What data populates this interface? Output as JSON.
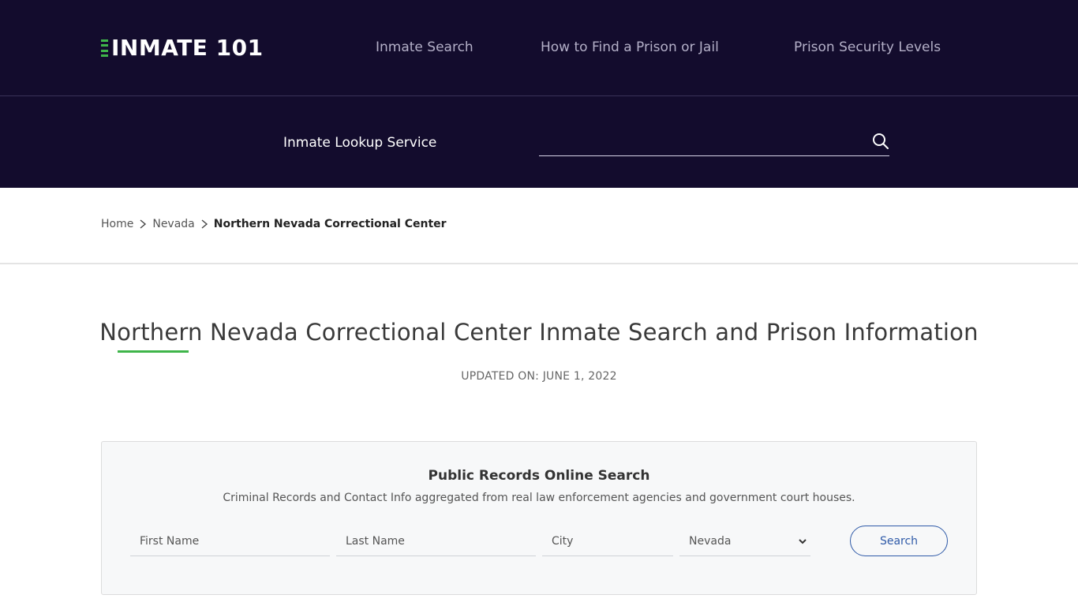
{
  "brand": {
    "logo_text": "INMATE 101",
    "accent_color": "#3fb54a",
    "header_bg": "#130c2d"
  },
  "nav": {
    "items": [
      {
        "label": "Inmate Search"
      },
      {
        "label": "How to Find a Prison or Jail"
      },
      {
        "label": "Prison Security Levels"
      }
    ]
  },
  "lookup": {
    "label": "Inmate Lookup Service",
    "value": "",
    "icon": "search-icon"
  },
  "breadcrumb": {
    "home": "Home",
    "state": "Nevada",
    "current": "Northern Nevada Correctional Center"
  },
  "page": {
    "title": "Northern Nevada Correctional Center Inmate Search and Prison Information",
    "updated": "UPDATED ON: JUNE 1, 2022"
  },
  "records_search": {
    "title": "Public Records Online Search",
    "description": "Criminal Records and Contact Info aggregated from real law enforcement agencies and government court houses.",
    "first_name_placeholder": "First Name",
    "last_name_placeholder": "Last Name",
    "city_placeholder": "City",
    "state_selected": "Nevada",
    "button_label": "Search",
    "button_color": "#2f5aa8"
  }
}
